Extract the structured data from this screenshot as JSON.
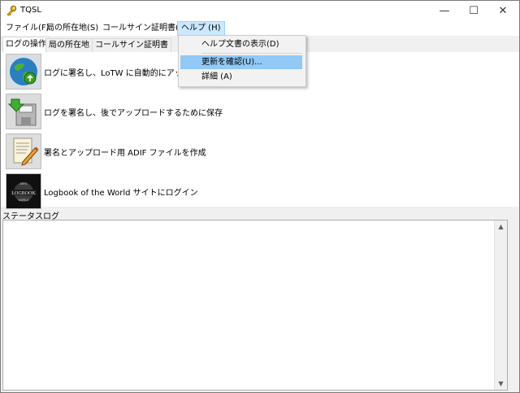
{
  "window": {
    "title": "TQSL",
    "minimize": "—",
    "maximize": "☐",
    "close": "✕"
  },
  "menu": {
    "items": [
      "ファイル(F)",
      "局の所在地(S)",
      "コールサイン証明書(C)",
      "ヘルプ (H)"
    ]
  },
  "tabs": [
    "ログの操作",
    "局の所在地",
    "コールサイン証明書"
  ],
  "actions": [
    {
      "label": "ログに署名し、LoTW に自動的にアップロー",
      "icon": "globe-icon"
    },
    {
      "label": "ログを署名し、後でアップロードするために保存",
      "icon": "save-to-disk-icon"
    },
    {
      "label": "署名とアップロード用 ADIF ファイルを作成",
      "icon": "edit-document-icon"
    },
    {
      "label": "Logbook of the World サイトにログイン",
      "icon": "lotw-logbook-icon"
    }
  ],
  "status": {
    "label": "ステータスログ",
    "log_text": ""
  },
  "help_menu": {
    "items": [
      "ヘルプ文書の表示(D)",
      "更新を確認(U)...",
      "詳細 (A)"
    ],
    "highlighted": "更新を確認(U)..."
  },
  "colors": {
    "menu_active": "#cce8ff",
    "menu_hover": "#91c9f7",
    "window_bg": "#f0f0f0"
  }
}
